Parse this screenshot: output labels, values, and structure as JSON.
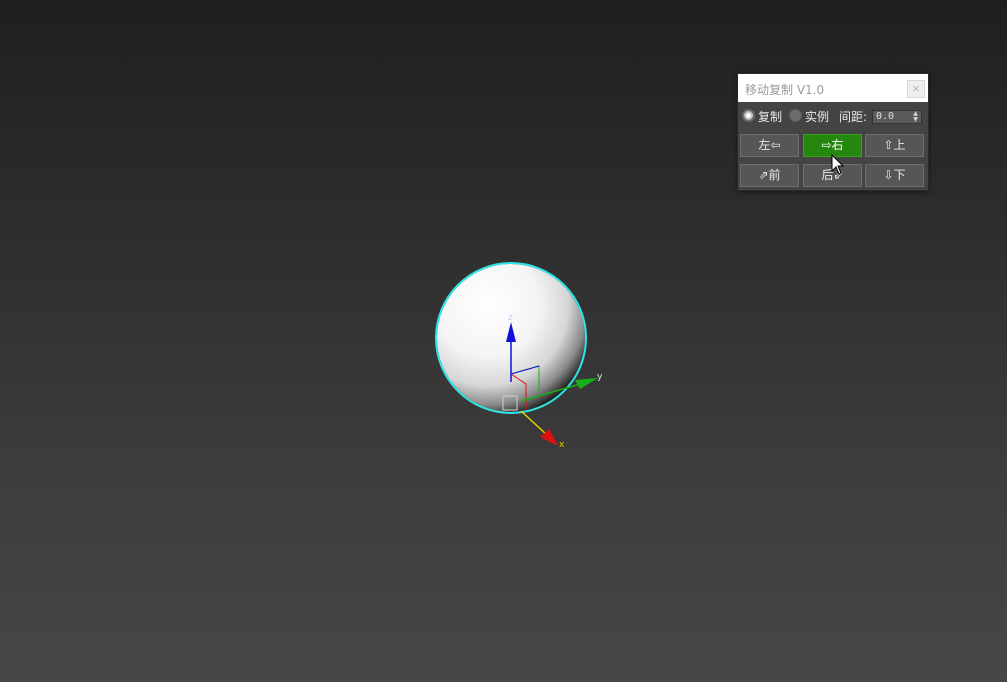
{
  "panel": {
    "title": "移动复制 V1.0",
    "close_label": "×",
    "copy_mode_label": "复制",
    "instance_mode_label": "实例",
    "copy_mode_selected": true,
    "spacing_label": "间距:",
    "spacing_value": "0.0",
    "spin_up": "▲",
    "spin_down": "▼",
    "buttons": {
      "left": "左⇦",
      "right": "⇨右",
      "up": "⇧上",
      "front": "⇗前",
      "back": "后⇙",
      "down": "⇩下"
    },
    "active_button": "right"
  },
  "scene": {
    "object": "sphere",
    "gizmo_axes": {
      "z": "z",
      "y": "y",
      "x": "x"
    }
  },
  "colors": {
    "selection_outline": "#2ee6e6",
    "axis_x": "#e01010",
    "axis_y": "#18b018",
    "axis_z": "#1010d8",
    "active_button": "#26870f"
  }
}
